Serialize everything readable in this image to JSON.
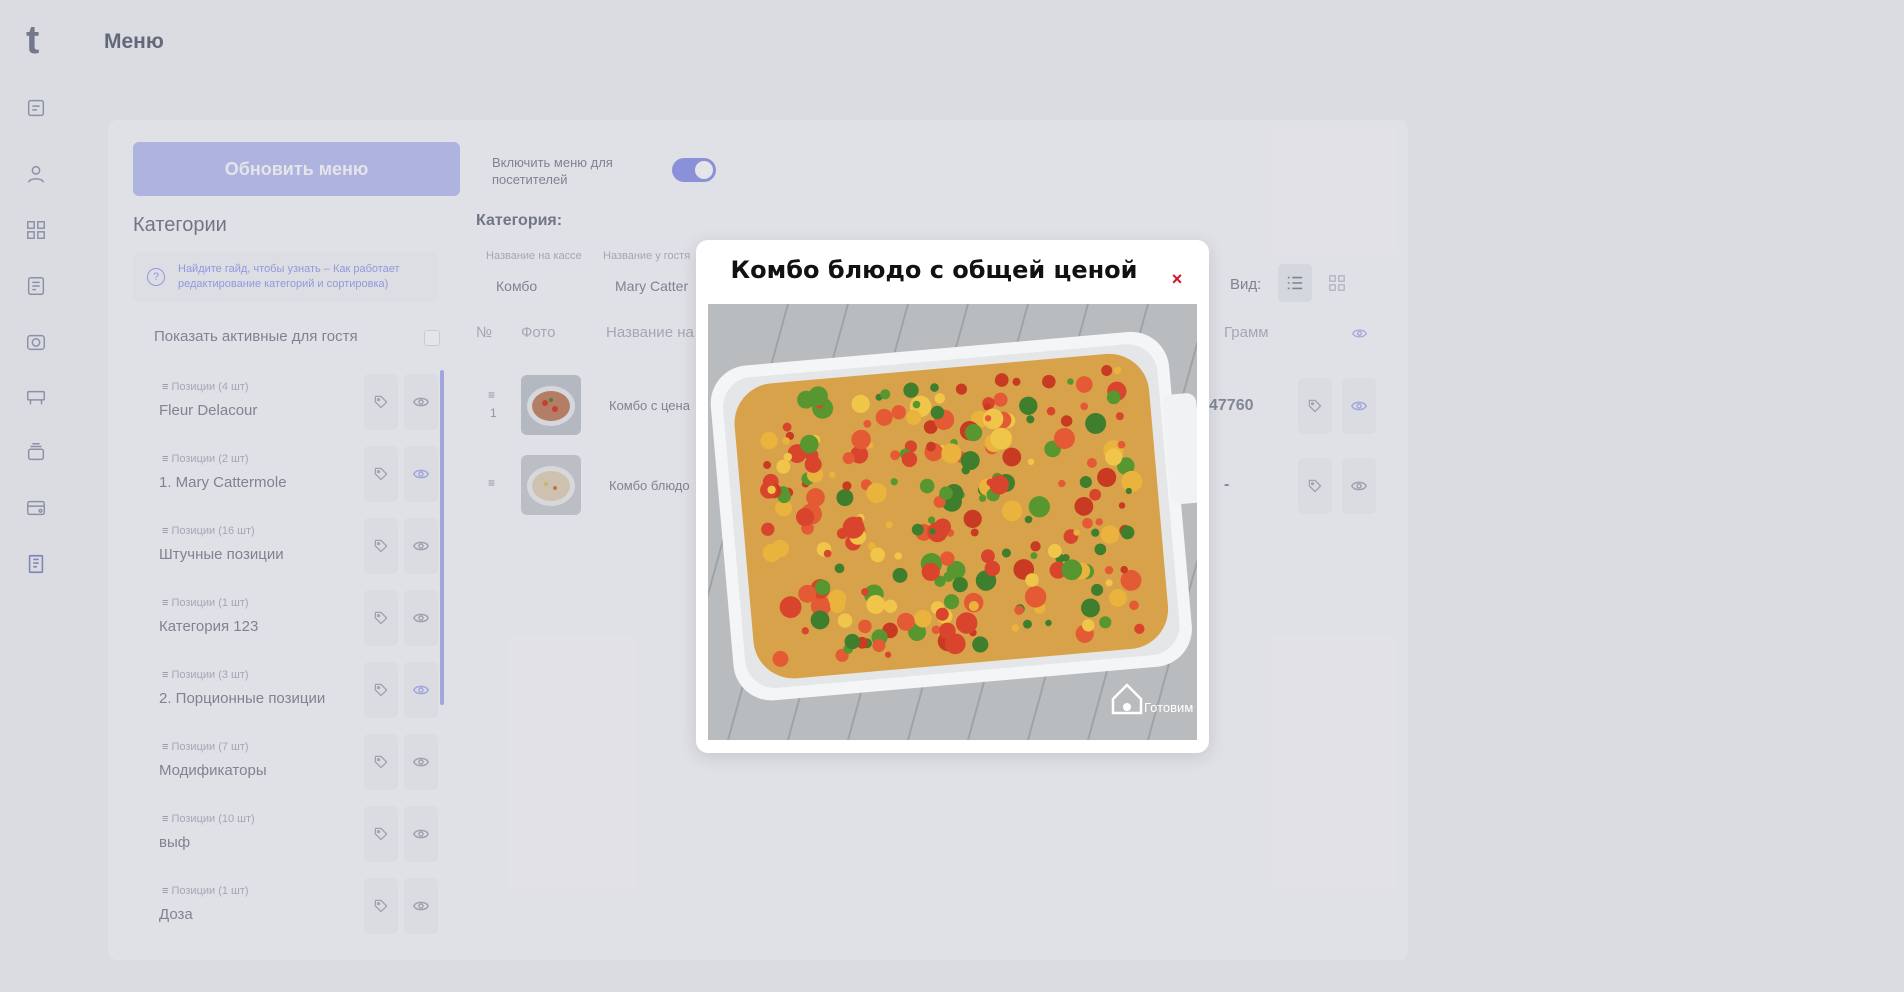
{
  "app": {
    "logo": "t",
    "page_title": "Меню"
  },
  "sidebar": {
    "items": [
      "doc-icon",
      "user-icon",
      "grid-icon",
      "card-icon",
      "camera-icon",
      "table-icon",
      "stack-icon",
      "wallet-icon",
      "book-icon"
    ]
  },
  "toolbar": {
    "update_label": "Обновить меню",
    "switch_label": "Включить меню для посетителей",
    "switch_on": true
  },
  "categories": {
    "title": "Категории",
    "hint": "Найдите гайд, чтобы узнать – Как работает редактирование категорий и сортировка)",
    "show_active_label": "Показать активные для гостя",
    "items": [
      {
        "count": "Позиции (4 шт)",
        "name": "Fleur Delacour",
        "visible": false
      },
      {
        "count": "Позиции (2 шт)",
        "name": "1. Mary Cattermole",
        "visible": true
      },
      {
        "count": "Позиции (16 шт)",
        "name": "Штучные позиции",
        "visible": false
      },
      {
        "count": "Позиции (1 шт)",
        "name": "Категория 123",
        "visible": false
      },
      {
        "count": "Позиции (3 шт)",
        "name": "2. Порционные позиции",
        "visible": true
      },
      {
        "count": "Позиции (7 шт)",
        "name": "Модификаторы",
        "visible": false
      },
      {
        "count": "Позиции (10 шт)",
        "name": "выф",
        "visible": false
      },
      {
        "count": "Позиции (1 шт)",
        "name": "Доза",
        "visible": false
      }
    ]
  },
  "category_panel": {
    "title": "Категория:",
    "cash_label": "Название на кассе",
    "cash_value": "Комбо",
    "guest_label": "Название у гостя",
    "guest_value": "Mary Catter",
    "view_label": "Вид:"
  },
  "table": {
    "headers": {
      "num": "№",
      "photo": "Фото",
      "name": "Название на",
      "grams": "Грамм"
    },
    "rows": [
      {
        "num": "1",
        "name": "Комбо с цена",
        "price": "47760"
      },
      {
        "num": "",
        "name": "Комбо блюдо",
        "price": "-"
      }
    ]
  },
  "modal": {
    "title": "Комбо блюдо с общей ценой",
    "close": "×",
    "watermark": "Готовим дома"
  },
  "colors": {
    "accent": "#9aa0ec",
    "close": "#d0142b",
    "background": "#f4f5f8"
  }
}
